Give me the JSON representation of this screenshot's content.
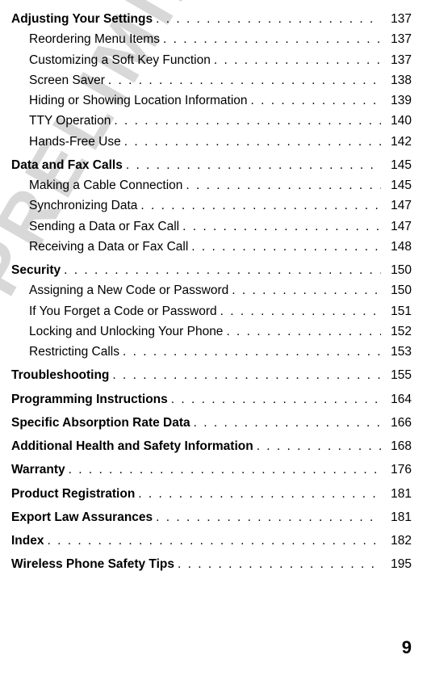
{
  "watermark": "PRELIMINARY",
  "pageNumber": "9",
  "toc": [
    {
      "type": "section",
      "title": "Adjusting Your Settings",
      "page": "137"
    },
    {
      "type": "sub",
      "title": "Reordering Menu Items",
      "page": "137"
    },
    {
      "type": "sub",
      "title": "Customizing a Soft Key Function",
      "page": "137"
    },
    {
      "type": "sub",
      "title": "Screen Saver",
      "page": "138"
    },
    {
      "type": "sub",
      "title": "Hiding or Showing Location Information",
      "page": "139"
    },
    {
      "type": "sub",
      "title": "TTY Operation",
      "page": "140"
    },
    {
      "type": "sub",
      "title": "Hands-Free Use",
      "page": "142"
    },
    {
      "type": "section",
      "title": "Data and Fax Calls",
      "page": "145"
    },
    {
      "type": "sub",
      "title": "Making a Cable Connection",
      "page": "145"
    },
    {
      "type": "sub",
      "title": "Synchronizing Data",
      "page": "147"
    },
    {
      "type": "sub",
      "title": "Sending a Data or Fax Call",
      "page": "147"
    },
    {
      "type": "sub",
      "title": "Receiving a Data or Fax Call",
      "page": "148"
    },
    {
      "type": "section",
      "title": "Security",
      "page": "150"
    },
    {
      "type": "sub",
      "title": "Assigning a New Code or Password",
      "page": "150"
    },
    {
      "type": "sub",
      "title": "If You Forget a Code or Password",
      "page": "151"
    },
    {
      "type": "sub",
      "title": "Locking and Unlocking Your Phone",
      "page": "152"
    },
    {
      "type": "sub",
      "title": "Restricting Calls",
      "page": "153"
    },
    {
      "type": "section",
      "title": "Troubleshooting",
      "page": "155"
    },
    {
      "type": "section",
      "title": "Programming Instructions",
      "page": "164"
    },
    {
      "type": "section",
      "title": "Specific Absorption Rate Data",
      "page": "166"
    },
    {
      "type": "section",
      "title": "Additional Health and Safety Information",
      "page": "168"
    },
    {
      "type": "section",
      "title": "Warranty",
      "page": "176"
    },
    {
      "type": "section",
      "title": "Product Registration",
      "page": "181"
    },
    {
      "type": "section",
      "title": "Export Law Assurances",
      "page": "181"
    },
    {
      "type": "section",
      "title": "Index",
      "page": "182"
    },
    {
      "type": "section",
      "title": "Wireless Phone Safety Tips",
      "page": "195"
    }
  ]
}
